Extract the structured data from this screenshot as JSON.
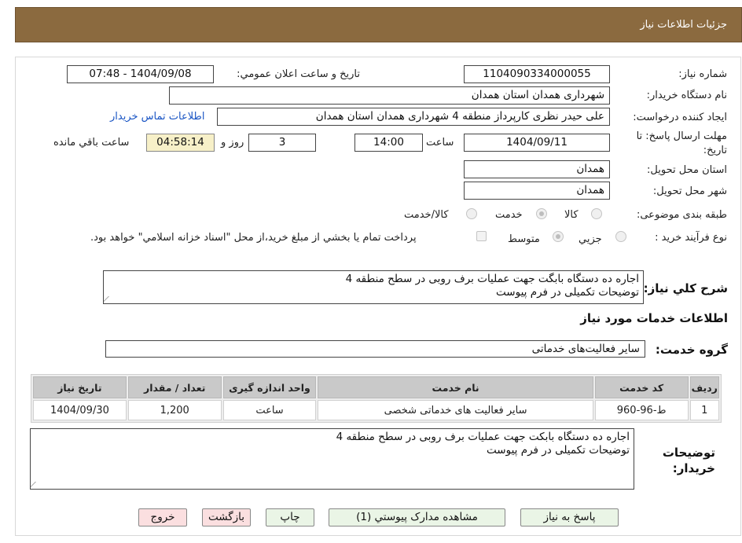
{
  "header": {
    "title": "جزئيات اطلاعات نياز"
  },
  "fields": {
    "need_number_label": "شماره نياز:",
    "need_number": "1104090334000055",
    "announce_label": "تاريخ و ساعت اعلان عمومي:",
    "announce_value": "1404/09/08 - 07:48",
    "buyer_label": "نام دستگاه خريدار:",
    "buyer_value": "شهرداری همدان استان همدان",
    "creator_label": "ايجاد كننده درخواست:",
    "creator_value": "علی حیدر نظری کارپرداز منطقه 4 شهرداری همدان استان همدان",
    "contact_link": "اطلاعات تماس خريدار",
    "deadline_label": "مهلت ارسال پاسخ: تا",
    "deadline_label2": "تاريخ:",
    "deadline_date": "1404/09/11",
    "time_label": "ساعت",
    "deadline_time": "14:00",
    "days_value": "3",
    "days_label": "روز و",
    "remaining_time": "04:58:14",
    "remaining_label": "ساعت باقي مانده",
    "province_label": "استان محل تحويل:",
    "province_value": "همدان",
    "city_label": "شهر محل تحويل:",
    "city_value": "همدان",
    "category_label": "طبقه بندی موضوعی:",
    "category_options": [
      "كالا",
      "خدمت",
      "كالا/خدمت"
    ],
    "process_label": "نوع فرآيند خريد :",
    "process_options": [
      "جزيي",
      "متوسط"
    ],
    "payment_note": "پرداخت تمام يا بخشي از مبلغ خريد،از محل \"اسناد خزانه اسلامي\" خواهد بود.",
    "summary_label": "شرح كلي نياز:",
    "summary_line1": "اجاره ده دستگاه بابگت جهت عملیات برف روبی در سطح منطقه 4",
    "summary_line2": "توضیحات تکمیلی در فرم پیوست",
    "services_title": "اطلاعات خدمات مورد نياز",
    "service_group_label": "گروه خدمت:",
    "service_group_value": "ساير فعاليت‌های خدماتی",
    "buyer_notes_label1": "توضيحات",
    "buyer_notes_label2": "خريدار:",
    "buyer_notes_line1": "اجاره ده دستگاه بابکت جهت عملیات برف روبی در سطح منطقه 4",
    "buyer_notes_line2": "توضیحات تکمیلی در فرم پیوست"
  },
  "table": {
    "headers": [
      "رديف",
      "كد خدمت",
      "نام خدمت",
      "واحد اندازه گيری",
      "تعداد / مقدار",
      "تاريخ نياز"
    ],
    "rows": [
      [
        "1",
        "ط-96-960",
        "ساير فعاليت های خدماتی شخصی",
        "ساعت",
        "1,200",
        "1404/09/30"
      ]
    ]
  },
  "buttons": {
    "reply": "پاسخ به نياز",
    "attachments": "مشاهده مدارک پيوستي (1)",
    "print": "چاپ",
    "back": "بازگشت",
    "exit": "خروج"
  },
  "colors": {
    "header": "#8b6a3f",
    "link": "#1a55c4",
    "timer_bg": "#f7f0c8",
    "button_green": "#eaf5e6",
    "button_pink": "#fbdfe0"
  }
}
